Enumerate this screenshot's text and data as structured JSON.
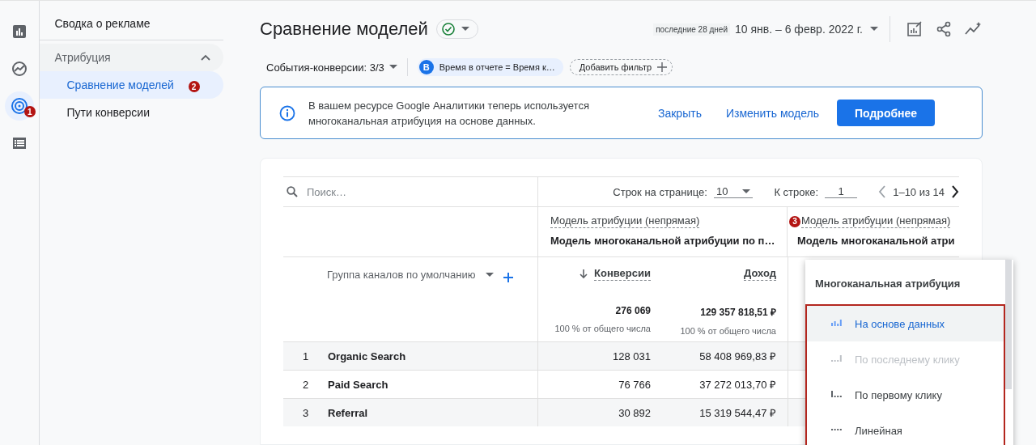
{
  "rail": [
    {
      "kind": "reports",
      "selected": false
    },
    {
      "kind": "explore",
      "selected": false
    },
    {
      "kind": "advertising",
      "selected": true,
      "badge": "1"
    },
    {
      "kind": "library",
      "selected": false
    }
  ],
  "nav": {
    "top": "Сводка о рекламе",
    "section": {
      "label": "Атрибуция",
      "expanded": true,
      "children": [
        {
          "label": "Сравнение моделей",
          "selected": true,
          "badge": "2"
        },
        {
          "label": "Пути конверсии",
          "selected": false
        }
      ]
    }
  },
  "header": {
    "title": "Сравнение моделей",
    "date_preset": "последние 28 дней",
    "date_range": "10 янв. – 6 февр. 2022 г."
  },
  "filters": {
    "conversions": "События-конверсии: 3/3",
    "chip": {
      "letter": "B",
      "text": "Время в отчете = Время к…"
    },
    "add_filter": "Добавить фильтр"
  },
  "banner": {
    "text": "В вашем ресурсе Google Аналитики теперь используется многоканальная атрибуция на основе данных.",
    "links": [
      "Закрыть",
      "Изменить модель"
    ],
    "primary": "Подробнее"
  },
  "table": {
    "search_placeholder": "Поиск…",
    "rows_per_page_label": "Строк на странице:",
    "rows_per_page": "10",
    "goto_label": "К строке:",
    "goto": "1",
    "range": "1–10 из 14",
    "models": [
      {
        "label": "Модель атрибуции (непрямая)",
        "model": "Модель многоканальной атрибуции по п…"
      },
      {
        "label": "Модель атрибуции (непрямая)",
        "model": "Модель многоканальной атри",
        "badge": "3"
      }
    ],
    "dimension": "Группа каналов по умолчанию",
    "metrics": [
      {
        "label": "Конверсии",
        "sorted": true
      },
      {
        "label": "Доход",
        "sorted": false
      }
    ],
    "totals": [
      "276 069",
      "129 357 818,51 ₽"
    ],
    "total_notes": [
      "100 % от общего числа",
      "100 % от общего числа"
    ],
    "rows": [
      {
        "index": "1",
        "channel": "Organic Search",
        "values": [
          "128 031",
          "58 408 969,83 ₽"
        ]
      },
      {
        "index": "2",
        "channel": "Paid Search",
        "values": [
          "76 766",
          "37 272 013,70 ₽"
        ]
      },
      {
        "index": "3",
        "channel": "Referral",
        "values": [
          "30 892",
          "15 319 544,47 ₽"
        ]
      }
    ]
  },
  "menu": {
    "title": "Многоканальная атрибуция",
    "options": [
      {
        "kind": "data",
        "label": "На основе данных",
        "selected": true,
        "disabled": false
      },
      {
        "kind": "last",
        "label": "По последнему клику",
        "selected": false,
        "disabled": true
      },
      {
        "kind": "first",
        "label": "По первому клику",
        "selected": false,
        "disabled": false
      },
      {
        "kind": "linear",
        "label": "Линейная",
        "selected": false,
        "disabled": false
      }
    ]
  }
}
